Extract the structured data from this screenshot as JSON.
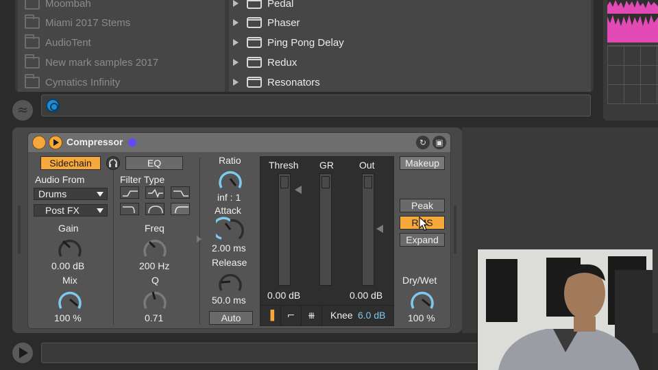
{
  "browser": {
    "places": [
      "Moombah",
      "Miami 2017 Stems",
      "AudioTent",
      "New mark samples 2017",
      "Cymatics Infinity"
    ],
    "items": [
      "Pedal",
      "Phaser",
      "Ping Pong Delay",
      "Redux",
      "Resonators"
    ]
  },
  "device": {
    "title": "Compressor",
    "sidechain_label": "Sidechain",
    "eq_label": "EQ",
    "audio_from_label": "Audio From",
    "audio_from_value": "Drums",
    "post_fx_value": "Post FX",
    "filter_type_label": "Filter Type",
    "gain_label": "Gain",
    "gain_value": "0.00 dB",
    "mix_label": "Mix",
    "mix_value": "100 %",
    "freq_label": "Freq",
    "freq_value": "200 Hz",
    "q_label": "Q",
    "q_value": "0.71",
    "ratio_label": "Ratio",
    "ratio_value": "inf : 1",
    "attack_label": "Attack",
    "attack_value": "2.00 ms",
    "release_label": "Release",
    "release_value": "50.0 ms",
    "auto_label": "Auto",
    "thresh_label": "Thresh",
    "gr_label": "GR",
    "out_label": "Out",
    "thresh_value": "0.00 dB",
    "out_value": "0.00 dB",
    "knee_label": "Knee",
    "knee_value": "6.0 dB",
    "makeup_label": "Makeup",
    "peak_label": "Peak",
    "rms_label": "RMS",
    "expand_label": "Expand",
    "drywet_label": "Dry/Wet",
    "drywet_value": "100 %"
  },
  "colors": {
    "accent": "#f6a83a",
    "knob_arc": "#7fc8f0",
    "knee_value": "#7fc8f0",
    "device_dot": "#5c4bff",
    "hotswap": "#1f8bd1"
  }
}
